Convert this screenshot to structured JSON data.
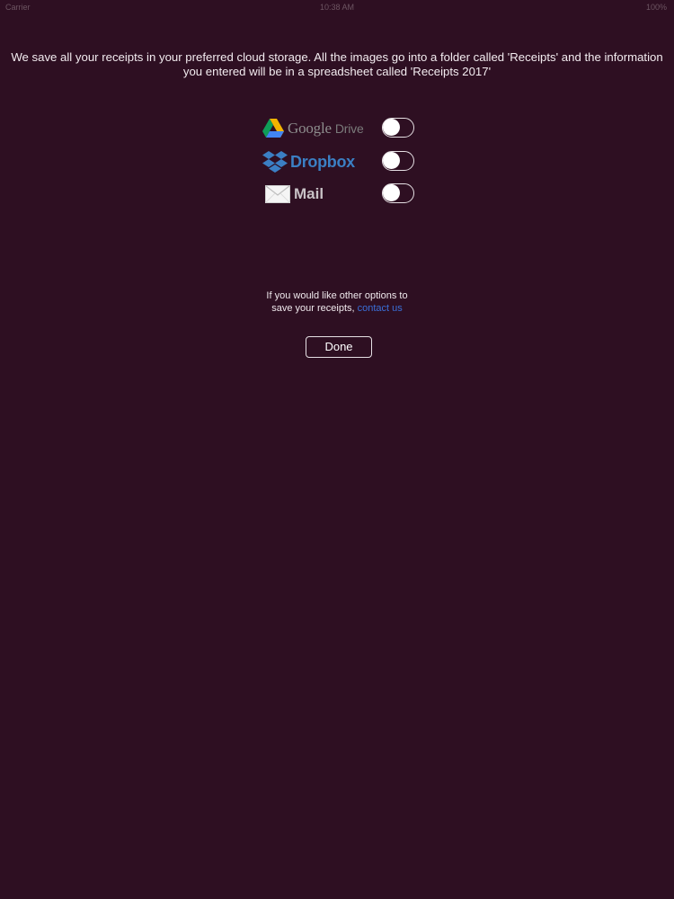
{
  "status_bar": {
    "carrier": "Carrier",
    "time": "10:38 AM",
    "battery": "100%"
  },
  "intro": {
    "line1": "We save all your receipts in your preferred cloud storage. All the images go into a folder called 'Receipts' and the information",
    "line2": "you entered will be in a spreadsheet called 'Receipts 2017'"
  },
  "options": {
    "google_drive": {
      "brand": "Google",
      "product": "Drive",
      "enabled": false
    },
    "dropbox": {
      "label": "Dropbox",
      "enabled": false
    },
    "mail": {
      "label": "Mail",
      "enabled": false
    }
  },
  "other_options": {
    "line1": "If you would like other options to",
    "line2_prefix": "save your receipts,",
    "link": "contact us"
  },
  "done_label": "Done",
  "colors": {
    "background": "#2e0f22",
    "link": "#3a6fd8",
    "dropbox_blue": "#3b7fc4"
  },
  "icons": {
    "google_drive": "google-drive-icon",
    "dropbox": "dropbox-icon",
    "mail": "mail-envelope-icon"
  }
}
